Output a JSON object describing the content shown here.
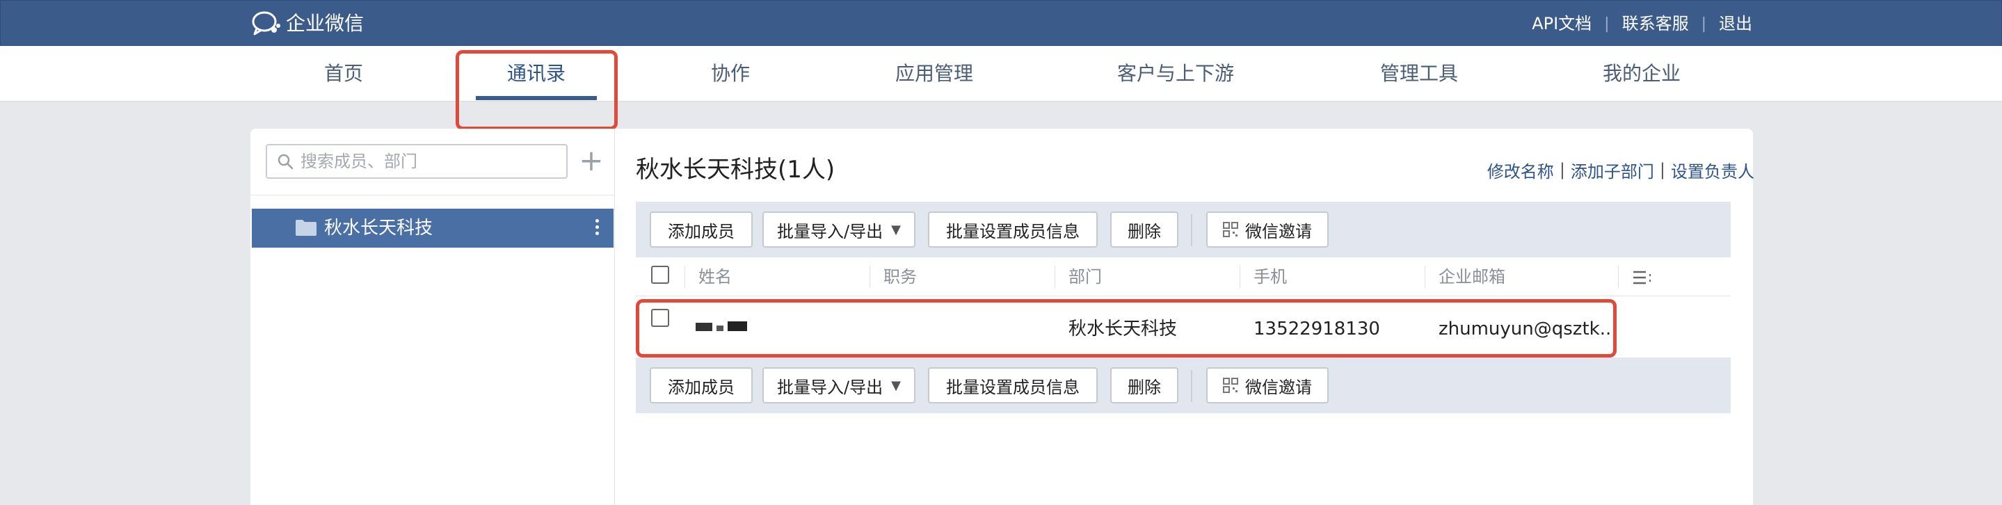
{
  "header": {
    "app_title": "企业微信",
    "links": [
      "API文档",
      "联系客服",
      "退出"
    ]
  },
  "nav": {
    "items": [
      "首页",
      "通讯录",
      "协作",
      "应用管理",
      "客户与上下游",
      "管理工具",
      "我的企业"
    ],
    "active": "通讯录"
  },
  "sidebar": {
    "search_placeholder": "搜索成员、部门",
    "departments": [
      {
        "name": "秋水长天科技",
        "selected": true
      }
    ]
  },
  "main": {
    "title": "秋水长天科技(1人)",
    "actions": [
      "修改名称",
      "添加子部门",
      "设置负责人"
    ],
    "toolbar": {
      "add_member": "添加成员",
      "import_export": "批量导入/导出",
      "batch_set": "批量设置成员信息",
      "delete": "删除",
      "wechat_invite": "微信邀请"
    },
    "table": {
      "columns": [
        "姓名",
        "职务",
        "部门",
        "手机",
        "企业邮箱"
      ],
      "rows": [
        {
          "name": "",
          "title": "",
          "department": "秋水长天科技",
          "phone": "13522918130",
          "email": "zhumuyun@qsztk..."
        }
      ]
    }
  },
  "colors": {
    "header_bg": "#3b5b8a",
    "accent": "#2e5389",
    "selected_dept_bg": "#4a6fa5",
    "toolbar_bg": "#e2e6ee",
    "annotation_red": "#e04a3a"
  }
}
